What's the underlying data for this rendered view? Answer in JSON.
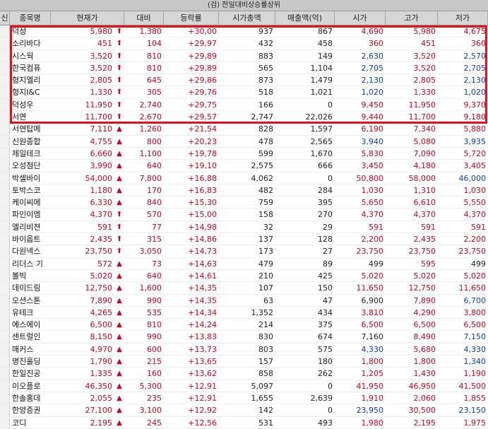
{
  "window": {
    "title": "(검) 전일대비상승률상위"
  },
  "columns": [
    "신",
    "종목명",
    "현재가",
    "대비",
    "등락률",
    "시가총액",
    "매출액(억)",
    "시가",
    "고가",
    "저가"
  ],
  "rows": [
    {
      "name": "덕성",
      "price": "5,980",
      "arrow": "⬆",
      "change": "1,380",
      "rate": "+30,00",
      "cap": "937",
      "sales": "867",
      "open": "4,690",
      "high": "5,980",
      "low": "4,675",
      "oc": "red",
      "hc": "red",
      "lc": "red"
    },
    {
      "name": "소리바다",
      "price": "451",
      "arrow": "⬆",
      "change": "104",
      "rate": "+29,97",
      "cap": "432",
      "sales": "458",
      "open": "360",
      "high": "451",
      "low": "360",
      "oc": "red",
      "hc": "red",
      "lc": "red"
    },
    {
      "name": "시스웍",
      "price": "3,520",
      "arrow": "⬆",
      "change": "810",
      "rate": "+29,89",
      "cap": "883",
      "sales": "149",
      "open": "2,630",
      "high": "3,520",
      "low": "2,570",
      "oc": "blue",
      "hc": "red",
      "lc": "blue"
    },
    {
      "name": "한국컴퓨",
      "price": "3,520",
      "arrow": "⬆",
      "change": "810",
      "rate": "+29,89",
      "cap": "565",
      "sales": "1,104",
      "open": "2,705",
      "high": "3,520",
      "low": "2,705",
      "oc": "blue",
      "hc": "red",
      "lc": "blue"
    },
    {
      "name": "형지엘리",
      "price": "2,805",
      "arrow": "⬆",
      "change": "645",
      "rate": "+29,86",
      "cap": "873",
      "sales": "1,479",
      "open": "2,130",
      "high": "2,805",
      "low": "2,130",
      "oc": "blue",
      "hc": "red",
      "lc": "blue"
    },
    {
      "name": "형지I&C",
      "price": "1,330",
      "arrow": "⬆",
      "change": "305",
      "rate": "+29,76",
      "cap": "518",
      "sales": "1,021",
      "open": "1,020",
      "high": "1,330",
      "low": "1,020",
      "oc": "blue",
      "hc": "red",
      "lc": "blue"
    },
    {
      "name": "덕성우",
      "price": "11,950",
      "arrow": "⬆",
      "change": "2,740",
      "rate": "+29,75",
      "cap": "166",
      "sales": "0",
      "open": "9,450",
      "high": "11,950",
      "low": "9,370",
      "oc": "red",
      "hc": "red",
      "lc": "red"
    },
    {
      "name": "서연",
      "price": "11,700",
      "arrow": "⬆",
      "change": "2,670",
      "rate": "+29,57",
      "cap": "2,747",
      "sales": "22,026",
      "open": "9,440",
      "high": "11,700",
      "low": "9,180",
      "oc": "red",
      "hc": "red",
      "lc": "red"
    },
    {
      "name": "서연탑메",
      "price": "7,110",
      "arrow": "▲",
      "change": "1,260",
      "rate": "+21,54",
      "cap": "828",
      "sales": "1,597",
      "open": "6,190",
      "high": "7,340",
      "low": "5,880",
      "oc": "red",
      "hc": "red",
      "lc": "red"
    },
    {
      "name": "신원종합",
      "price": "4,755",
      "arrow": "▲",
      "change": "800",
      "rate": "+20,23",
      "cap": "478",
      "sales": "2,565",
      "open": "3,940",
      "high": "5,080",
      "low": "3,935",
      "oc": "blue",
      "hc": "red",
      "lc": "blue"
    },
    {
      "name": "제일테크",
      "price": "6,660",
      "arrow": "▲",
      "change": "1,100",
      "rate": "+19,78",
      "cap": "599",
      "sales": "1,670",
      "open": "5,830",
      "high": "7,090",
      "low": "5,720",
      "oc": "red",
      "hc": "red",
      "lc": "red"
    },
    {
      "name": "오성첨단",
      "price": "3,990",
      "arrow": "▲",
      "change": "640",
      "rate": "+19,10",
      "cap": "2,575",
      "sales": "666",
      "open": "3,450",
      "high": "4,180",
      "low": "3,405",
      "oc": "red",
      "hc": "red",
      "lc": "red"
    },
    {
      "name": "박셀바이",
      "price": "54,000",
      "arrow": "▲",
      "change": "7,800",
      "rate": "+16,88",
      "cap": "4,062",
      "sales": "0",
      "open": "50,800",
      "high": "58,000",
      "low": "46,000",
      "oc": "red",
      "hc": "red",
      "lc": "blue"
    },
    {
      "name": "토박스코",
      "price": "1,180",
      "arrow": "▲",
      "change": "170",
      "rate": "+16,83",
      "cap": "482",
      "sales": "284",
      "open": "1,030",
      "high": "1,310",
      "low": "1,030",
      "oc": "red",
      "hc": "red",
      "lc": "red"
    },
    {
      "name": "케이씨에",
      "price": "6,330",
      "arrow": "▲",
      "change": "840",
      "rate": "+15,30",
      "cap": "759",
      "sales": "395",
      "open": "5,650",
      "high": "6,610",
      "low": "5,550",
      "oc": "red",
      "hc": "red",
      "lc": "red"
    },
    {
      "name": "파인이엠",
      "price": "4,370",
      "arrow": "⬆",
      "change": "570",
      "rate": "+15,00",
      "cap": "158",
      "sales": "270",
      "open": "4,370",
      "high": "4,370",
      "low": "4,370",
      "oc": "red",
      "hc": "red",
      "lc": "red"
    },
    {
      "name": "엘리비젼",
      "price": "591",
      "arrow": "⬆",
      "change": "77",
      "rate": "+14,98",
      "cap": "32",
      "sales": "29",
      "open": "591",
      "high": "591",
      "low": "591",
      "oc": "red",
      "hc": "red",
      "lc": "red"
    },
    {
      "name": "바이옵트",
      "price": "2,435",
      "arrow": "⬆",
      "change": "315",
      "rate": "+14,86",
      "cap": "137",
      "sales": "128",
      "open": "2,200",
      "high": "2,435",
      "low": "2,200",
      "oc": "red",
      "hc": "red",
      "lc": "red"
    },
    {
      "name": "다원넥스",
      "price": "23,750",
      "arrow": "⬆",
      "change": "3,050",
      "rate": "+14,73",
      "cap": "173",
      "sales": "27",
      "open": "23,750",
      "high": "23,750",
      "low": "23,750",
      "oc": "red",
      "hc": "red",
      "lc": "red"
    },
    {
      "name": "리더스 기",
      "price": "572",
      "arrow": "▲",
      "change": "73",
      "rate": "+14,63",
      "cap": "479",
      "sales": "89",
      "open": "499",
      "high": "595",
      "low": "499",
      "oc": "blk",
      "hc": "red",
      "lc": "blk"
    },
    {
      "name": "볼빅",
      "price": "5,020",
      "arrow": "▲",
      "change": "640",
      "rate": "+14,61",
      "cap": "210",
      "sales": "425",
      "open": "5,020",
      "high": "5,020",
      "low": "5,020",
      "oc": "red",
      "hc": "red",
      "lc": "red"
    },
    {
      "name": "데이드림",
      "price": "12,750",
      "arrow": "▲",
      "change": "1,600",
      "rate": "+14,35",
      "cap": "107",
      "sales": "150",
      "open": "11,650",
      "high": "12,750",
      "low": "11,650",
      "oc": "red",
      "hc": "red",
      "lc": "red"
    },
    {
      "name": "오션스톤",
      "price": "7,890",
      "arrow": "▲",
      "change": "990",
      "rate": "+14,35",
      "cap": "63",
      "sales": "47",
      "open": "6,900",
      "high": "7,890",
      "low": "6,700",
      "oc": "blk",
      "hc": "red",
      "lc": "blue"
    },
    {
      "name": "유테크",
      "price": "4,265",
      "arrow": "▲",
      "change": "535",
      "rate": "+14,34",
      "cap": "1,352",
      "sales": "434",
      "open": "3,810",
      "high": "4,290",
      "low": "3,800",
      "oc": "red",
      "hc": "red",
      "lc": "red"
    },
    {
      "name": "에스에이",
      "price": "6,500",
      "arrow": "▲",
      "change": "810",
      "rate": "+14,24",
      "cap": "214",
      "sales": "375",
      "open": "6,500",
      "high": "6,500",
      "low": "6,500",
      "oc": "red",
      "hc": "red",
      "lc": "red"
    },
    {
      "name": "센트럴인",
      "price": "8,150",
      "arrow": "▲",
      "change": "990",
      "rate": "+13,83",
      "cap": "830",
      "sales": "674",
      "open": "7,160",
      "high": "8,490",
      "low": "7,150",
      "oc": "blk",
      "hc": "red",
      "lc": "blue"
    },
    {
      "name": "매커스",
      "price": "4,970",
      "arrow": "▲",
      "change": "600",
      "rate": "+13,73",
      "cap": "803",
      "sales": "575",
      "open": "4,330",
      "high": "5,680",
      "low": "4,330",
      "oc": "blue",
      "hc": "red",
      "lc": "blue"
    },
    {
      "name": "명진홀딩",
      "price": "1,790",
      "arrow": "▲",
      "change": "215",
      "rate": "+13,65",
      "cap": "157",
      "sales": "180",
      "open": "1,800",
      "high": "1,800",
      "low": "1,340",
      "oc": "red",
      "hc": "red",
      "lc": "blue"
    },
    {
      "name": "한일진공",
      "price": "1,335",
      "arrow": "▲",
      "change": "160",
      "rate": "+13,62",
      "cap": "858",
      "sales": "262",
      "open": "1,205",
      "high": "1,430",
      "low": "1,190",
      "oc": "red",
      "hc": "red",
      "lc": "red"
    },
    {
      "name": "이오플로",
      "price": "46,350",
      "arrow": "▲",
      "change": "5,300",
      "rate": "+12,91",
      "cap": "5,097",
      "sales": "0",
      "open": "41,950",
      "high": "46,950",
      "low": "41,500",
      "oc": "red",
      "hc": "red",
      "lc": "red"
    },
    {
      "name": "한솔홈데",
      "price": "2,055",
      "arrow": "▲",
      "change": "235",
      "rate": "+12,91",
      "cap": "1,655",
      "sales": "2,639",
      "open": "1,910",
      "high": "2,060",
      "low": "1,855",
      "oc": "red",
      "hc": "red",
      "lc": "red"
    },
    {
      "name": "한양증권",
      "price": "27,100",
      "arrow": "▲",
      "change": "3,100",
      "rate": "+12,92",
      "cap": "142",
      "sales": "0",
      "open": "23,950",
      "high": "30,500",
      "low": "23,150",
      "oc": "blue",
      "hc": "red",
      "lc": "blue"
    },
    {
      "name": "코디",
      "price": "2,195",
      "arrow": "▲",
      "change": "245",
      "rate": "+12,56",
      "cap": "531",
      "sales": "493",
      "open": "1,980",
      "high": "2,195",
      "low": "1,975",
      "oc": "red",
      "hc": "red",
      "lc": "red"
    }
  ],
  "colors": {
    "up": "#d0021b",
    "down": "#0a3cc8",
    "highlight": "#e8101a"
  }
}
